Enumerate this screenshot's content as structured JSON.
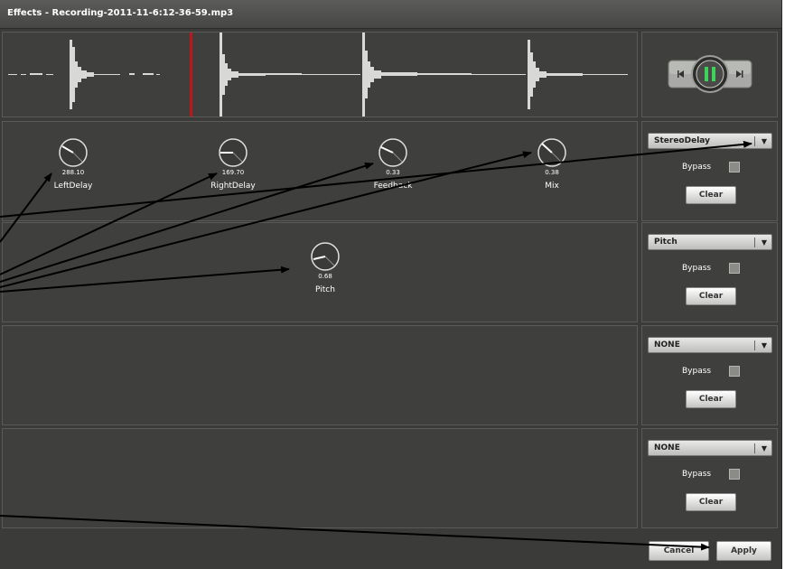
{
  "window": {
    "title": "Effects - Recording-2011-11-6:12-36-59.mp3"
  },
  "transport": {
    "prev_icon": "skip-back-icon",
    "pause_icon": "pause-icon",
    "next_icon": "skip-forward-icon",
    "accent": "#3fd25a"
  },
  "slots": [
    {
      "effect": "StereoDelay",
      "bypass_label": "Bypass",
      "clear_label": "Clear",
      "knobs": [
        {
          "name": "LeftDelay",
          "value": "288.10"
        },
        {
          "name": "RightDelay",
          "value": "169.70"
        },
        {
          "name": "Feedback",
          "value": "0.33"
        },
        {
          "name": "Mix",
          "value": "0.38"
        }
      ]
    },
    {
      "effect": "Pitch",
      "bypass_label": "Bypass",
      "clear_label": "Clear",
      "knobs": [
        {
          "name": "Pitch",
          "value": "0.68"
        }
      ]
    },
    {
      "effect": "NONE",
      "bypass_label": "Bypass",
      "clear_label": "Clear",
      "knobs": []
    },
    {
      "effect": "NONE",
      "bypass_label": "Bypass",
      "clear_label": "Clear",
      "knobs": []
    }
  ],
  "footer": {
    "cancel_label": "Cancel",
    "apply_label": "Apply"
  },
  "colors": {
    "playhead": "#c0161b",
    "waveform": "#d8d8d6",
    "background": "#3b3c39"
  }
}
